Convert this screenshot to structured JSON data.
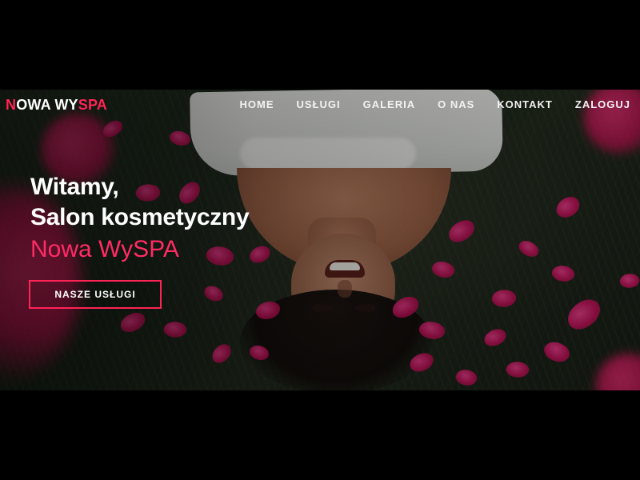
{
  "brand": {
    "n": "N",
    "owa_wy": "OWA WY",
    "spa": "SPA"
  },
  "nav": {
    "items": [
      "HOME",
      "USŁUGI",
      "GALERIA",
      "O NAS",
      "KONTAKT",
      "ZALOGUJ"
    ]
  },
  "hero": {
    "line1": "Witamy,",
    "line2": "Salon kosmetyczny",
    "accent": "Nowa WySPA",
    "cta": "NASZE USŁUGI"
  },
  "colors": {
    "accent": "#ff2356",
    "text_light": "#ffffff",
    "background": "#000000"
  }
}
